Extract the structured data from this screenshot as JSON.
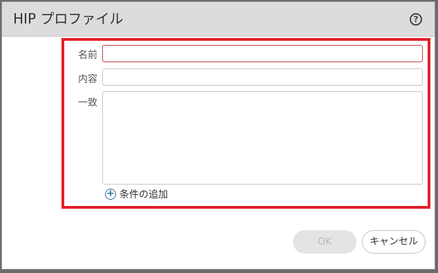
{
  "dialog": {
    "title": "HIP プロファイル",
    "help_icon": "question-circle-icon"
  },
  "form": {
    "name_label": "名前",
    "name_value": "",
    "description_label": "内容",
    "description_value": "",
    "match_label": "一致",
    "match_value": "",
    "add_condition_label": "条件の追加",
    "add_condition_icon": "plus-circle-icon",
    "highlight_color": "#e0202a"
  },
  "buttons": {
    "ok_label": "OK",
    "cancel_label": "キャンセル"
  }
}
